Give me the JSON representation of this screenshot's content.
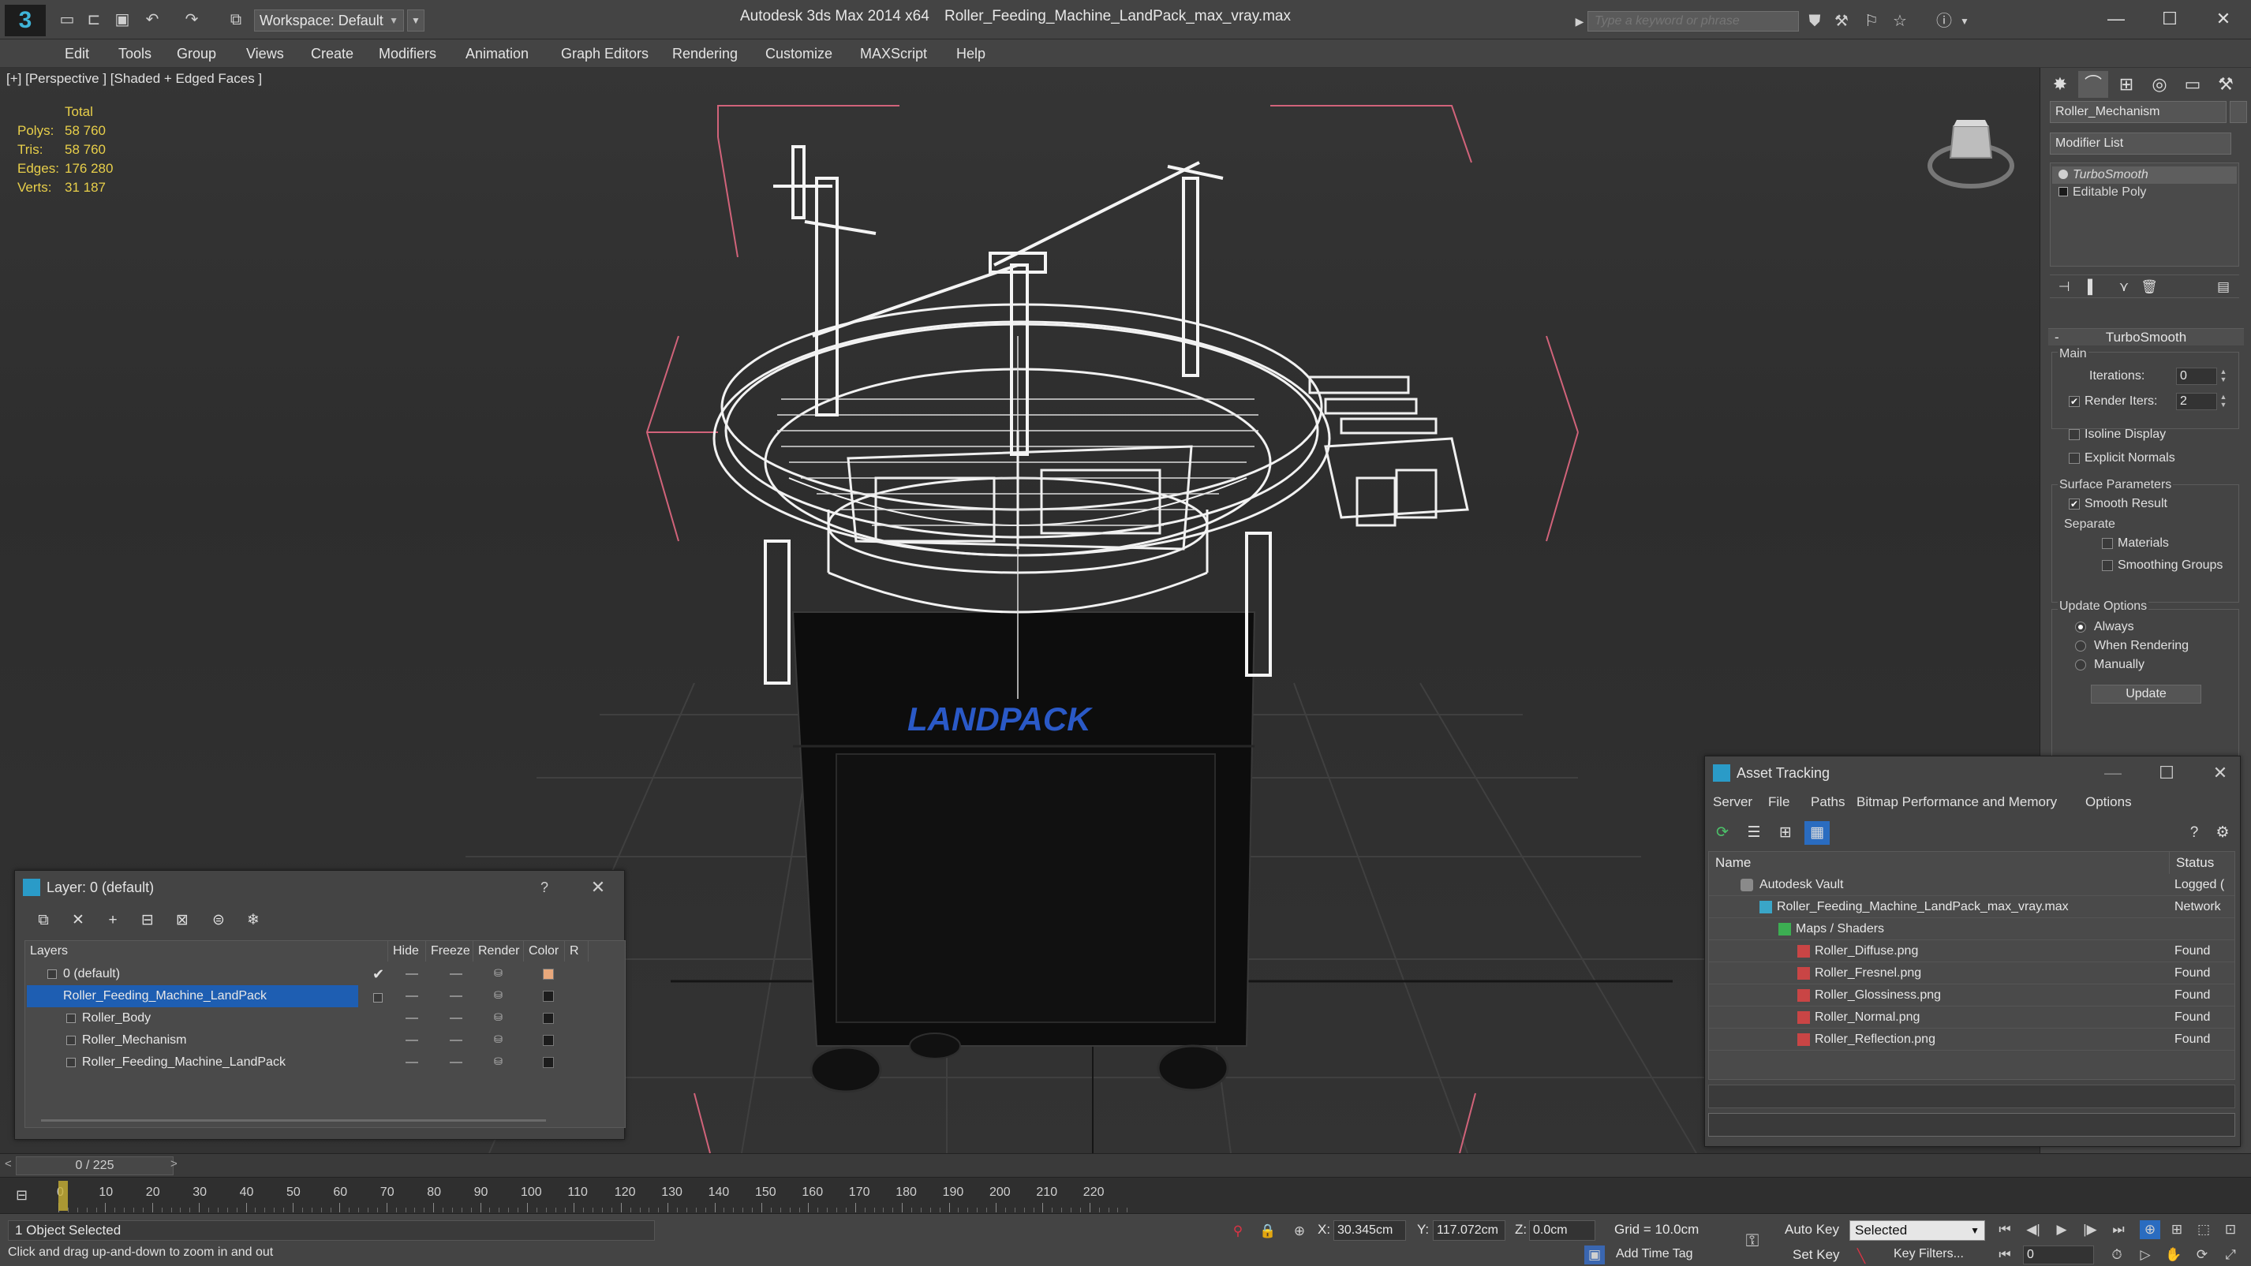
{
  "titlebar": {
    "logo_glyph": "3",
    "app_title": "Autodesk 3ds Max  2014 x64",
    "file_title": "Roller_Feeding_Machine_LandPack_max_vray.max",
    "workspace_label": "Workspace: Default",
    "search_placeholder": "Type a keyword or phrase",
    "window_controls": {
      "minimize": "—",
      "maximize": "☐",
      "close": "✕"
    }
  },
  "menubar": {
    "items": [
      "Edit",
      "Tools",
      "Group",
      "Views",
      "Create",
      "Modifiers",
      "Animation",
      "Graph Editors",
      "Rendering",
      "Customize",
      "MAXScript",
      "Help"
    ]
  },
  "viewport": {
    "label": "[+] [Perspective ] [Shaded + Edged Faces ]",
    "stats": {
      "total_label": "Total",
      "rows": [
        {
          "label": "Polys:",
          "value": "58 760"
        },
        {
          "label": "Tris:",
          "value": "58 760"
        },
        {
          "label": "Edges:",
          "value": "176 280"
        },
        {
          "label": "Verts:",
          "value": "31 187"
        }
      ]
    }
  },
  "command_panel": {
    "object_name": "Roller_Mechanism",
    "modifier_list_label": "Modifier List",
    "stack": [
      {
        "label": "TurboSmooth",
        "selected": true
      },
      {
        "label": "Editable Poly",
        "selected": false
      }
    ],
    "turbosmooth": {
      "title": "TurboSmooth",
      "main_label": "Main",
      "iterations_label": "Iterations:",
      "iterations_value": "0",
      "render_iters_label": "Render Iters:",
      "render_iters_value": "2",
      "render_iters_checked": true,
      "isoline_label": "Isoline Display",
      "explicit_normals_label": "Explicit Normals",
      "surface_params_label": "Surface Parameters",
      "smooth_result_label": "Smooth Result",
      "separate_label": "Separate",
      "materials_label": "Materials",
      "smoothing_groups_label": "Smoothing Groups",
      "update_options_label": "Update Options",
      "always_label": "Always",
      "when_rendering_label": "When Rendering",
      "manually_label": "Manually",
      "update_button": "Update"
    }
  },
  "layer_panel": {
    "title": "Layer: 0 (default)",
    "help": "?",
    "close": "✕",
    "columns": {
      "layers": "Layers",
      "hide": "Hide",
      "freeze": "Freeze",
      "render": "Render",
      "color": "Color",
      "radiosity": "R"
    },
    "rows": [
      {
        "name": "0 (default)",
        "indent": 0,
        "active": true,
        "selected": false,
        "color": "#e8a87c"
      },
      {
        "name": "Roller_Feeding_Machine_LandPack",
        "indent": 0,
        "active": false,
        "selected": true,
        "color": "#1c1c1c"
      },
      {
        "name": "Roller_Body",
        "indent": 1,
        "active": false,
        "selected": false,
        "color": "#1c1c1c"
      },
      {
        "name": "Roller_Mechanism",
        "indent": 1,
        "active": false,
        "selected": false,
        "color": "#1c1c1c"
      },
      {
        "name": "Roller_Feeding_Machine_LandPack",
        "indent": 1,
        "active": false,
        "selected": false,
        "color": "#1c1c1c"
      }
    ]
  },
  "asset_panel": {
    "title": "Asset Tracking",
    "window_controls": {
      "minimize": "—",
      "maximize": "☐",
      "close": "✕"
    },
    "menu": [
      "Server",
      "File",
      "Paths",
      "Bitmap Performance and Memory",
      "Options"
    ],
    "columns": {
      "name": "Name",
      "status": "Status"
    },
    "rows": [
      {
        "name": "Autodesk Vault",
        "status": "Logged (",
        "level": 0,
        "icon": "vault"
      },
      {
        "name": "Roller_Feeding_Machine_LandPack_max_vray.max",
        "status": "Network",
        "level": 1,
        "icon": "max"
      },
      {
        "name": "Maps / Shaders",
        "status": "",
        "level": 2,
        "icon": "map"
      },
      {
        "name": "Roller_Diffuse.png",
        "status": "Found",
        "level": 3,
        "icon": "file"
      },
      {
        "name": "Roller_Fresnel.png",
        "status": "Found",
        "level": 3,
        "icon": "file"
      },
      {
        "name": "Roller_Glossiness.png",
        "status": "Found",
        "level": 3,
        "icon": "file"
      },
      {
        "name": "Roller_Normal.png",
        "status": "Found",
        "level": 3,
        "icon": "file"
      },
      {
        "name": "Roller_Reflection.png",
        "status": "Found",
        "level": 3,
        "icon": "file"
      }
    ]
  },
  "timeline": {
    "slider_label": "0 / 225",
    "ticks": [
      "0",
      "10",
      "20",
      "30",
      "40",
      "50",
      "60",
      "70",
      "80",
      "90",
      "100",
      "110",
      "120",
      "130",
      "140",
      "150",
      "160",
      "170",
      "180",
      "190",
      "200",
      "210",
      "220"
    ]
  },
  "statusbar": {
    "selection": "1 Object Selected",
    "prompt": "Click and drag up-and-down to zoom in and out",
    "x_label": "X:",
    "x_value": "30.345cm",
    "y_label": "Y:",
    "y_value": "117.072cm",
    "z_label": "Z:",
    "z_value": "0.0cm",
    "grid": "Grid = 10.0cm",
    "add_time_tag": "Add Time Tag",
    "auto_key": "Auto Key",
    "set_key": "Set Key",
    "selected_drop": "Selected",
    "key_filters": "Key Filters...",
    "frame_value": "0"
  }
}
